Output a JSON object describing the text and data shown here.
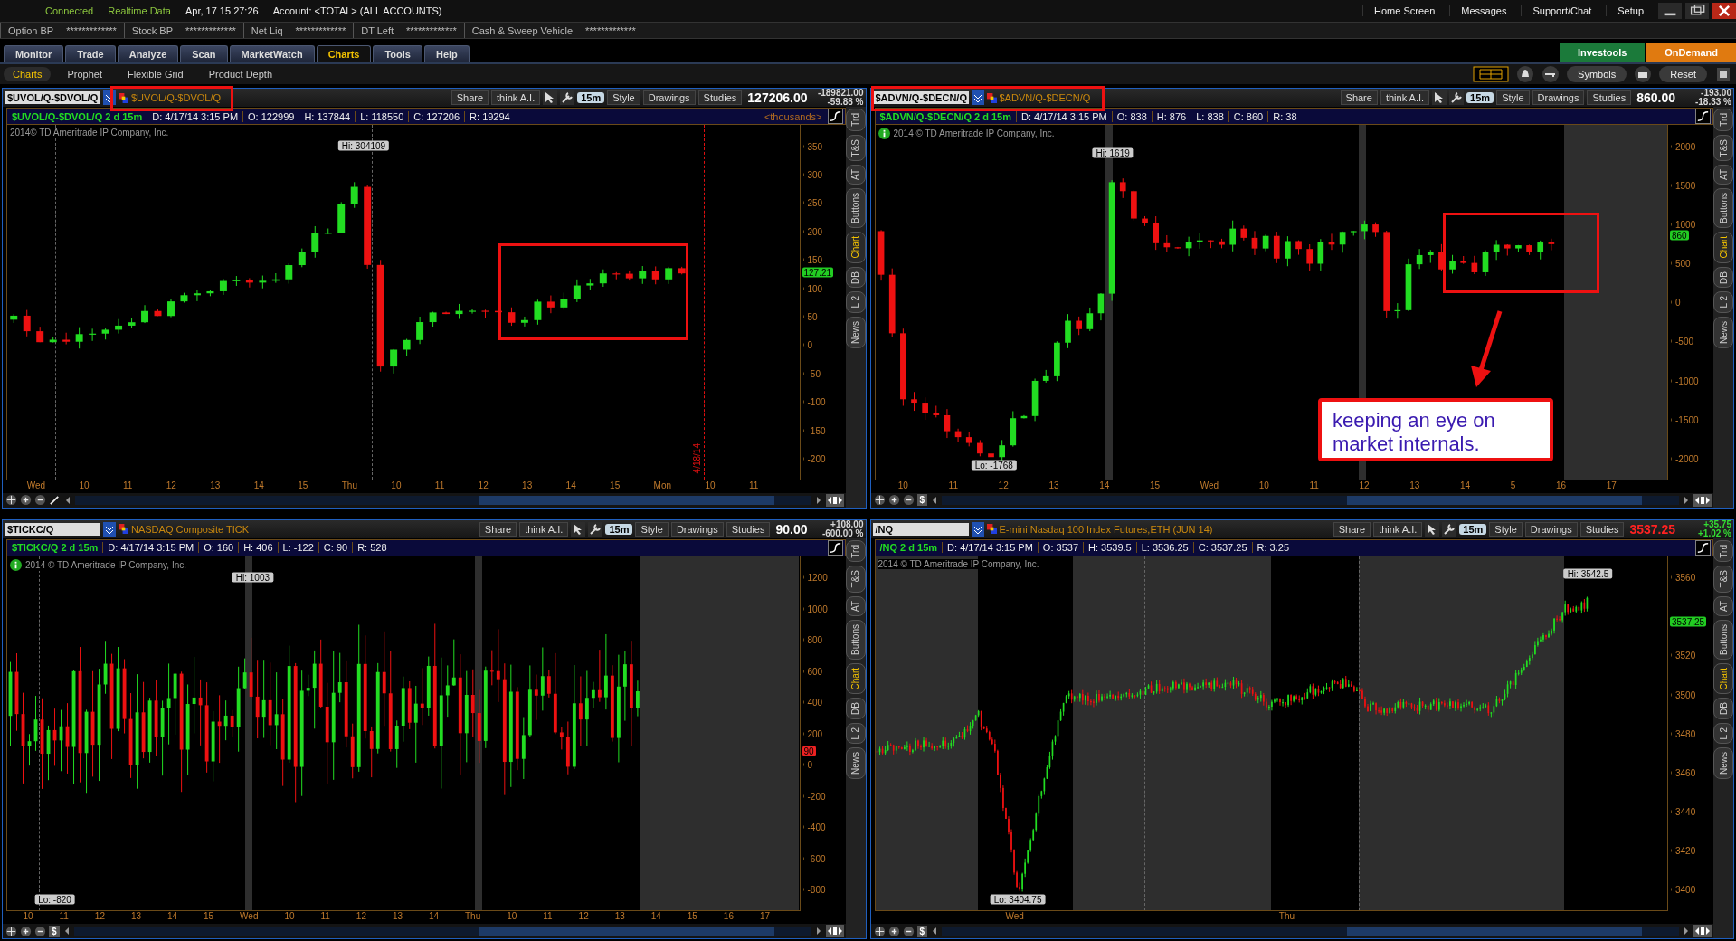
{
  "status_bar": {
    "connection": "Connected",
    "data_feed": "Realtime Data",
    "datetime": "Apr, 17  15:27:26",
    "account": "Account: <TOTAL> (ALL ACCOUNTS)"
  },
  "top_links": [
    "Home Screen",
    "Messages",
    "Support/Chat",
    "Setup"
  ],
  "balances": [
    {
      "label": "Option BP",
      "value": "*************"
    },
    {
      "label": "Stock BP",
      "value": "*************"
    },
    {
      "label": "Net Liq",
      "value": "*************"
    },
    {
      "label": "DT Left",
      "value": "*************"
    },
    {
      "label": "Cash & Sweep Vehicle",
      "value": "*************"
    }
  ],
  "main_tabs": [
    {
      "label": "Monitor",
      "selected": false
    },
    {
      "label": "Trade",
      "selected": false
    },
    {
      "label": "Analyze",
      "selected": false
    },
    {
      "label": "Scan",
      "selected": false
    },
    {
      "label": "MarketWatch",
      "selected": false
    },
    {
      "label": "Charts",
      "selected": true
    },
    {
      "label": "Tools",
      "selected": false
    },
    {
      "label": "Help",
      "selected": false
    }
  ],
  "sub_tabs": [
    {
      "label": "Charts",
      "selected": true
    },
    {
      "label": "Prophet",
      "selected": false
    },
    {
      "label": "Flexible Grid",
      "selected": false
    },
    {
      "label": "Product Depth",
      "selected": false
    }
  ],
  "promo_buttons": [
    "Investools",
    "OnDemand"
  ],
  "grid_toolbar": [
    "Symbols",
    "Reset"
  ],
  "panels": [
    {
      "symbol": "$UVOL/Q-$DVOL/Q",
      "description": "$UVOL/Q-$DVOL/Q",
      "toolbar": [
        "Share",
        "think A.I.",
        "Style",
        "Drawings",
        "Studies"
      ],
      "timeframe": "15m",
      "price": {
        "text": "127206.00",
        "color": "#ffffff"
      },
      "change": {
        "lines": [
          "-189821.00",
          "-59.88 %"
        ],
        "color": "#d8d8d8"
      },
      "info_title": "$UVOL/Q-$DVOL/Q 2 d 15m",
      "info_fields": [
        "D: 4/17/14 3:15 PM",
        "O: 122999",
        "H: 137844",
        "L: 118550",
        "C: 127206",
        "R: 19294"
      ],
      "unit_label": "<thousands>",
      "watermark": "2014© TD Ameritrade IP Company, Inc.",
      "info_icon": false,
      "y_ticks": [
        "350",
        "300",
        "250",
        "200",
        "150",
        "100",
        "50",
        "0",
        "-50",
        "-100",
        "-150",
        "-200"
      ],
      "x_ticks": [
        "Wed",
        "10",
        "11",
        "12",
        "13",
        "14",
        "15",
        "Thu",
        "10",
        "11",
        "12",
        "13",
        "14",
        "15",
        "Mon",
        "10",
        "11"
      ],
      "price_tag": {
        "text": "127.21",
        "color": "#22cc22"
      },
      "hi_label": "Hi: 304109",
      "marker_label": "4/18/14",
      "side_tabs": [
        {
          "label": "Trd",
          "selected": false
        },
        {
          "label": "T&S",
          "selected": false
        },
        {
          "label": "AT",
          "selected": false
        },
        {
          "label": "Buttons",
          "selected": false
        },
        {
          "label": "Chart",
          "selected": true
        },
        {
          "label": "DB",
          "selected": false
        },
        {
          "label": "L 2",
          "selected": false
        },
        {
          "label": "News",
          "selected": false
        }
      ]
    },
    {
      "symbol": "$ADVN/Q-$DECN/Q",
      "description": "$ADVN/Q-$DECN/Q",
      "toolbar": [
        "Share",
        "think A.I.",
        "Style",
        "Drawings",
        "Studies"
      ],
      "timeframe": "15m",
      "price": {
        "text": "860.00",
        "color": "#ffffff"
      },
      "change": {
        "lines": [
          "-193.00",
          "-18.33 %"
        ],
        "color": "#d8d8d8"
      },
      "info_title": "$ADVN/Q-$DECN/Q 2 d 15m",
      "info_fields": [
        "D: 4/17/14 3:15 PM",
        "O: 838",
        "H: 876",
        "L: 838",
        "C: 860",
        "R: 38"
      ],
      "watermark": "2014 © TD Ameritrade IP Company, Inc.",
      "info_icon": true,
      "footer_button": "$",
      "y_ticks": [
        "2000",
        "1500",
        "1000",
        "500",
        "0",
        "-500",
        "-1000",
        "-1500",
        "-2000"
      ],
      "x_ticks": [
        "10",
        "11",
        "12",
        "13",
        "14",
        "15",
        "Wed",
        "10",
        "11",
        "12",
        "13",
        "14",
        "5",
        "16",
        "17"
      ],
      "price_tag": {
        "text": "860",
        "color": "#22cc22"
      },
      "hi_label": "Hi: 1619",
      "lo_label": "Lo: -1768",
      "side_tabs": [
        {
          "label": "Trd",
          "selected": false
        },
        {
          "label": "T&S",
          "selected": false
        },
        {
          "label": "AT",
          "selected": false
        },
        {
          "label": "Buttons",
          "selected": false
        },
        {
          "label": "Chart",
          "selected": true
        },
        {
          "label": "DB",
          "selected": false
        },
        {
          "label": "L 2",
          "selected": false
        },
        {
          "label": "News",
          "selected": false
        }
      ]
    },
    {
      "symbol": "$TICKC/Q",
      "description": "NASDAQ Composite TICK",
      "toolbar": [
        "Share",
        "think A.I.",
        "Style",
        "Drawings",
        "Studies"
      ],
      "timeframe": "15m",
      "price": {
        "text": "90.00",
        "color": "#ffffff"
      },
      "change": {
        "lines": [
          "+108.00",
          "-600.00 %"
        ],
        "color": "#d8d8d8"
      },
      "info_title": "$TICKC/Q 2 d 15m",
      "info_fields": [
        "D: 4/17/14 3:15 PM",
        "O: 160",
        "H: 406",
        "L: -122",
        "C: 90",
        "R: 528"
      ],
      "watermark": "2014 © TD Ameritrade IP Company, Inc.",
      "info_icon": true,
      "footer_button": "$",
      "y_ticks": [
        "1200",
        "1000",
        "800",
        "600",
        "400",
        "200",
        "0",
        "-200",
        "-400",
        "-600",
        "-800"
      ],
      "x_ticks": [
        "10",
        "11",
        "12",
        "13",
        "14",
        "15",
        "Wed",
        "10",
        "11",
        "12",
        "13",
        "14",
        "Thu",
        "10",
        "11",
        "12",
        "13",
        "14",
        "15",
        "16",
        "17"
      ],
      "price_tag": {
        "text": "90",
        "color": "#ee2222"
      },
      "hi_label": "Hi: 1003",
      "lo_label": "Lo: -820",
      "side_tabs": [
        {
          "label": "Trd",
          "selected": false
        },
        {
          "label": "T&S",
          "selected": false
        },
        {
          "label": "AT",
          "selected": false
        },
        {
          "label": "Buttons",
          "selected": false
        },
        {
          "label": "Chart",
          "selected": true
        },
        {
          "label": "DB",
          "selected": false
        },
        {
          "label": "L 2",
          "selected": false
        },
        {
          "label": "News",
          "selected": false
        }
      ]
    },
    {
      "symbol": "/NQ",
      "description": "E-mini Nasdaq 100 Index Futures,ETH (JUN 14)",
      "toolbar": [
        "Share",
        "think A.I.",
        "Style",
        "Drawings",
        "Studies"
      ],
      "timeframe": "15m",
      "price": {
        "text": "3537.25",
        "color": "#ff2222"
      },
      "change": {
        "lines": [
          "+35.75",
          "+1.02 %"
        ],
        "color": "#33dd33"
      },
      "info_title": "/NQ 2 d 15m",
      "info_fields": [
        "D: 4/17/14 3:15 PM",
        "O: 3537",
        "H: 3539.5",
        "L: 3536.25",
        "C: 3537.25",
        "R: 3.25"
      ],
      "watermark": "2014 © TD Ameritrade IP Company, Inc.",
      "info_icon": false,
      "footer_button": "$",
      "y_ticks": [
        "3560",
        "3520",
        "3500",
        "3480",
        "3460",
        "3440",
        "3420",
        "3400"
      ],
      "x_ticks": [
        "Wed",
        "Thu"
      ],
      "price_tag": {
        "text": "3537.25",
        "color": "#22cc22"
      },
      "hi_label": "Hi: 3542.5",
      "lo_label": "Lo: 3404.75",
      "side_tabs": [
        {
          "label": "Trd",
          "selected": false
        },
        {
          "label": "T&S",
          "selected": false
        },
        {
          "label": "AT",
          "selected": false
        },
        {
          "label": "Buttons",
          "selected": false
        },
        {
          "label": "Chart",
          "selected": true
        },
        {
          "label": "DB",
          "selected": false
        },
        {
          "label": "L 2",
          "selected": false
        },
        {
          "label": "News",
          "selected": false
        }
      ]
    }
  ],
  "callout": {
    "text": "keeping an eye on market internals."
  }
}
